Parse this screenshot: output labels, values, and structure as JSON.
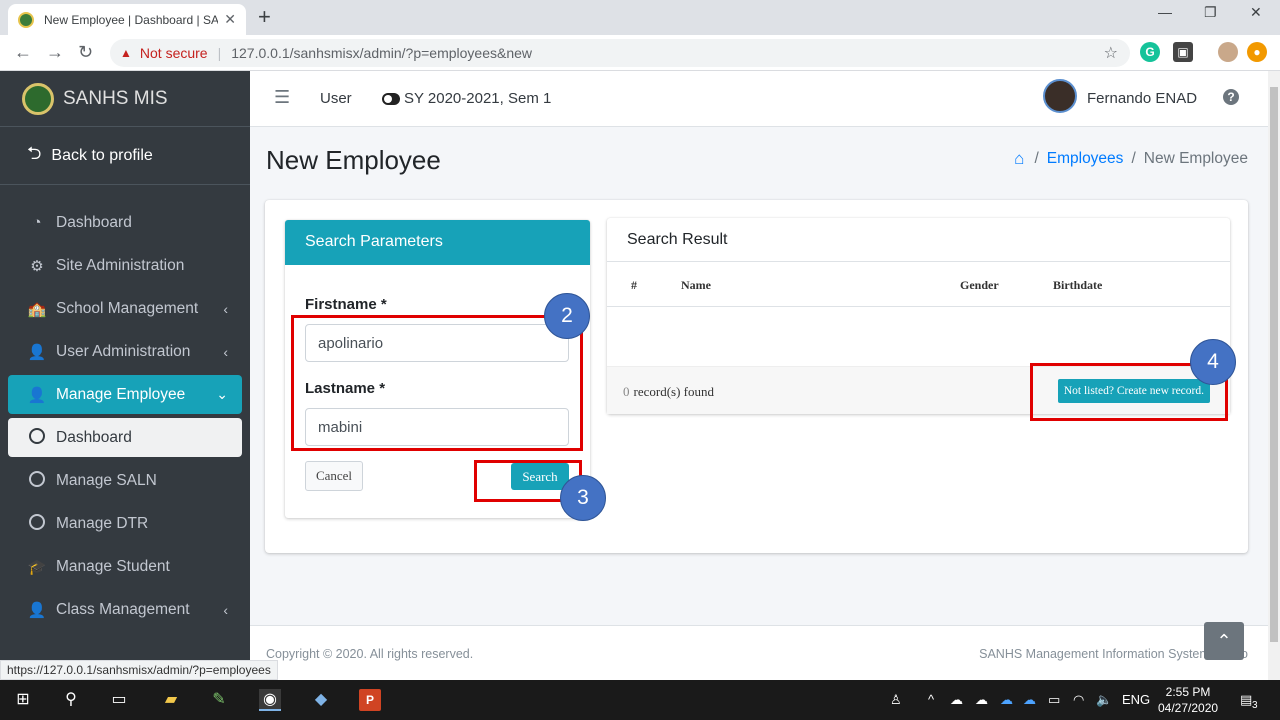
{
  "browser": {
    "tab_title": "New Employee | Dashboard | SAN",
    "security_label": "Not secure",
    "url": "127.0.0.1/sanhsmisx/admin/?p=employees&new",
    "status_url": "https://127.0.0.1/sanhsmisx/admin/?p=employees"
  },
  "sidebar": {
    "brand": "SANHS MIS",
    "back_label": "Back to profile",
    "items": [
      {
        "label": "Dashboard"
      },
      {
        "label": "Site Administration"
      },
      {
        "label": "School Management"
      },
      {
        "label": "User Administration"
      },
      {
        "label": "Manage Employee"
      },
      {
        "label": "Dashboard"
      },
      {
        "label": "Manage SALN"
      },
      {
        "label": "Manage DTR"
      },
      {
        "label": "Manage Student"
      },
      {
        "label": "Class Management"
      }
    ]
  },
  "topnav": {
    "user_label": "User",
    "school_year": "SY 2020-2021, Sem 1",
    "username": "Fernando ENAD"
  },
  "page": {
    "title": "New Employee",
    "breadcrumb": {
      "parent": "Employees",
      "current": "New Employee"
    }
  },
  "search": {
    "header": "Search Parameters",
    "firstname_label": "Firstname *",
    "firstname_value": "apolinario",
    "lastname_label": "Lastname *",
    "lastname_value": "mabini",
    "cancel_label": "Cancel",
    "search_label": "Search"
  },
  "result": {
    "header": "Search Result",
    "columns": [
      "#",
      "Name",
      "Gender",
      "Birthdate"
    ],
    "count": "0",
    "count_suffix": "record(s) found",
    "create_label": "Not listed? Create new record."
  },
  "annotations": [
    "2",
    "3",
    "4"
  ],
  "footer": {
    "copyright": "Copyright © 2020. All rights reserved.",
    "system": "SANHS Management Information System Versio"
  },
  "taskbar": {
    "lang": "ENG",
    "time": "2:55 PM",
    "date": "04/27/2020",
    "notif": "3"
  },
  "colors": {
    "accent": "#17a2b8",
    "sidebar": "#343a40",
    "annotation_red": "#e00000",
    "annotation_blue": "#4472c4"
  }
}
